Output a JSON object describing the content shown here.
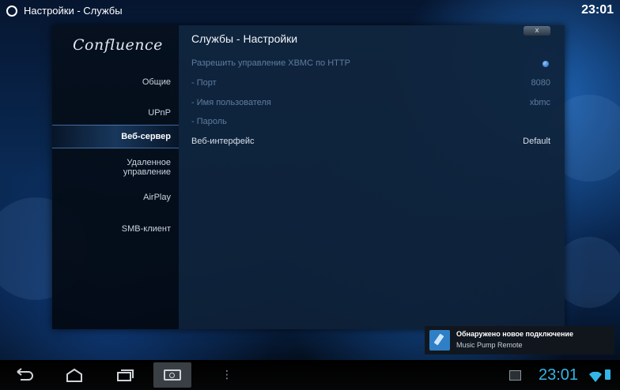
{
  "statusbar": {
    "title": "Настройки - Службы",
    "clock": "23:01"
  },
  "window": {
    "logo": "Confluence",
    "close_label": "x",
    "panel_title": "Службы - Настройки",
    "nav": [
      {
        "label": "Общие",
        "active": false
      },
      {
        "label": "UPnP",
        "active": false
      },
      {
        "label": "Веб-сервер",
        "active": true
      },
      {
        "label_line1": "Удаленное",
        "label_line2": "управление",
        "active": false
      },
      {
        "label": "AirPlay",
        "active": false
      },
      {
        "label": "SMB-клиент",
        "active": false
      }
    ],
    "settings": [
      {
        "label": "Разрешить управление XBMC по HTTP",
        "value": ""
      },
      {
        "label": "- Порт",
        "value": "8080"
      },
      {
        "label": "- Имя пользователя",
        "value": "xbmc"
      },
      {
        "label": "- Пароль",
        "value": ""
      },
      {
        "label": "Веб-интерфейс",
        "value": "Default"
      }
    ]
  },
  "notification": {
    "title": "Обнаружено новое подключение",
    "subtitle": "Music Pump Remote"
  },
  "navbar": {
    "clock": "23:01",
    "accent": "#33b5e5"
  }
}
